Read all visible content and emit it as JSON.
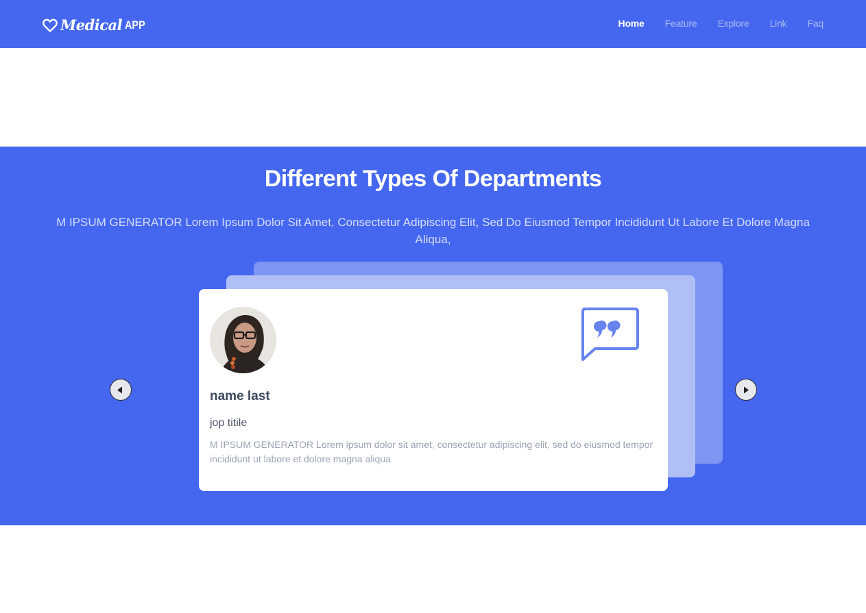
{
  "brand": {
    "name_italic": "Medical",
    "name_suffix": "APP",
    "icon": "heart-outline-icon"
  },
  "nav": {
    "items": [
      {
        "label": "Home",
        "active": true
      },
      {
        "label": "Feature",
        "active": false
      },
      {
        "label": "Explore",
        "active": false
      },
      {
        "label": "Link",
        "active": false
      },
      {
        "label": "Faq",
        "active": false
      }
    ]
  },
  "departments": {
    "title": "Different Types Of Departments",
    "subtitle": "M IPSUM GENERATOR Lorem Ipsum Dolor Sit Amet, Consectetur Adipiscing Elit, Sed Do Eiusmod Tempor Incididunt Ut Labore Et Dolore Magna Aliqua,"
  },
  "testimonial": {
    "name": "name last",
    "job_title": "jop titile",
    "text": "M IPSUM GENERATOR Lorem ipsum dolor sit amet, consectetur adipiscing elit, sed do eiusmod tempor incididunt ut labore et dolore magna aliqua",
    "quote_icon": "speech-bubble-quote-icon"
  },
  "carousel": {
    "prev_icon": "play-left-icon",
    "next_icon": "play-right-icon"
  },
  "colors": {
    "primary": "#4567ef",
    "card_layer_mid": "#b0c0f7",
    "card_layer_back": "#7d95f3",
    "quote_icon": "#6683ef",
    "nav_inactive": "#a9b8f4"
  }
}
